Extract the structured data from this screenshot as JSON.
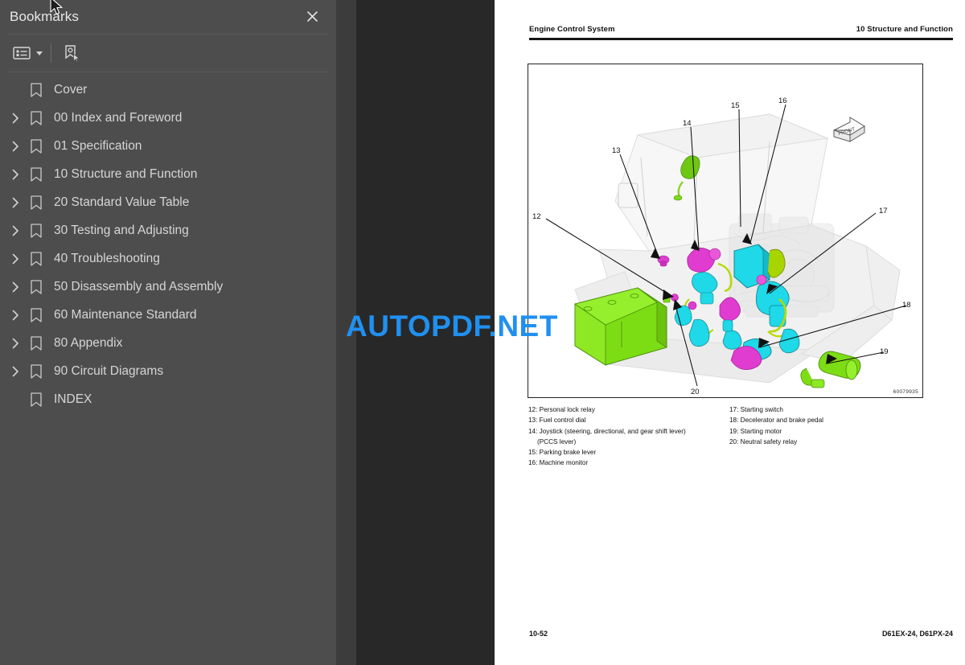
{
  "sidebar": {
    "title": "Bookmarks",
    "close_label": "✕",
    "toolbar": {
      "options_icon": "list-options-icon",
      "options_caret": "chevron-down-icon",
      "new_bookmark_icon": "new-bookmark-icon"
    },
    "items": [
      {
        "label": "Cover",
        "expandable": false
      },
      {
        "label": "00 Index and Foreword",
        "expandable": true
      },
      {
        "label": "01 Specification",
        "expandable": true
      },
      {
        "label": "10 Structure and Function",
        "expandable": true
      },
      {
        "label": "20 Standard Value Table",
        "expandable": true
      },
      {
        "label": "30 Testing and Adjusting",
        "expandable": true
      },
      {
        "label": "40 Troubleshooting",
        "expandable": true
      },
      {
        "label": "50 Disassembly and Assembly",
        "expandable": true
      },
      {
        "label": "60 Maintenance Standard",
        "expandable": true
      },
      {
        "label": "80 Appendix",
        "expandable": true
      },
      {
        "label": "90 Circuit Diagrams",
        "expandable": true
      },
      {
        "label": "INDEX",
        "expandable": false
      }
    ]
  },
  "document": {
    "header_left": "Engine Control System",
    "header_right": "10 Structure and Function",
    "figure_id": "60079935",
    "figure_front_label": "FRONT",
    "callouts": [
      "12",
      "13",
      "14",
      "15",
      "16",
      "17",
      "18",
      "19",
      "20"
    ],
    "legend_left": [
      {
        "text": "12: Personal lock relay"
      },
      {
        "text": "13: Fuel control dial"
      },
      {
        "text": "14: Joystick (steering, directional, and gear shift lever)"
      },
      {
        "text": "(PCCS lever)",
        "continuation": true
      },
      {
        "text": "15: Parking brake lever"
      },
      {
        "text": "16: Machine monitor"
      }
    ],
    "legend_right": [
      {
        "text": "17: Starting switch"
      },
      {
        "text": "18: Decelerator and brake pedal"
      },
      {
        "text": "19: Starting motor"
      },
      {
        "text": "20: Neutral safety relay"
      }
    ],
    "footer_left": "10-52",
    "footer_right": "D61EX-24, D61PX-24"
  },
  "watermark": {
    "text": "AUTOPDF.NET",
    "color": "#2090f0"
  },
  "colors": {
    "sidebar_bg": "#4d4d4d",
    "viewer_bg": "#282828",
    "gutter_bg": "#3c3c3c",
    "page_bg": "#ffffff",
    "highlight_cyan": "#1fd8e8",
    "highlight_magenta": "#e03cd0",
    "highlight_green": "#7ddd14"
  }
}
